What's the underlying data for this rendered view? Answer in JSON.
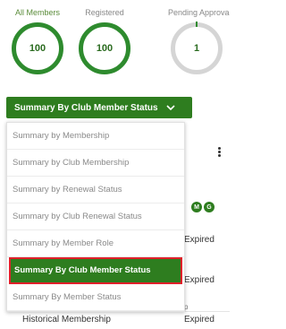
{
  "stats": [
    {
      "label": "All Members",
      "value": "100"
    },
    {
      "label": "Registered",
      "value": "100"
    },
    {
      "label": "Pending Approva",
      "value": "1"
    }
  ],
  "dropdown": {
    "trigger_label": "Summary By Club Member Status",
    "items": [
      "Summary by Membership",
      "Summary by Club Membership",
      "Summary by Renewal Status",
      "Summary by Club Renewal Status",
      "Summary by Member Role",
      "Summary By Club Member Status",
      "Summary By Member Status"
    ],
    "selected_index": 5
  },
  "background": {
    "badge_1": "M",
    "badge_2": "G",
    "status_1": "Expired",
    "status_2": "Expired",
    "status_3": "Expired",
    "row_label": "Historical Membership",
    "fragment": "p"
  },
  "colors": {
    "accent": "#2e7d1f",
    "highlight_outline": "#e0202a"
  }
}
